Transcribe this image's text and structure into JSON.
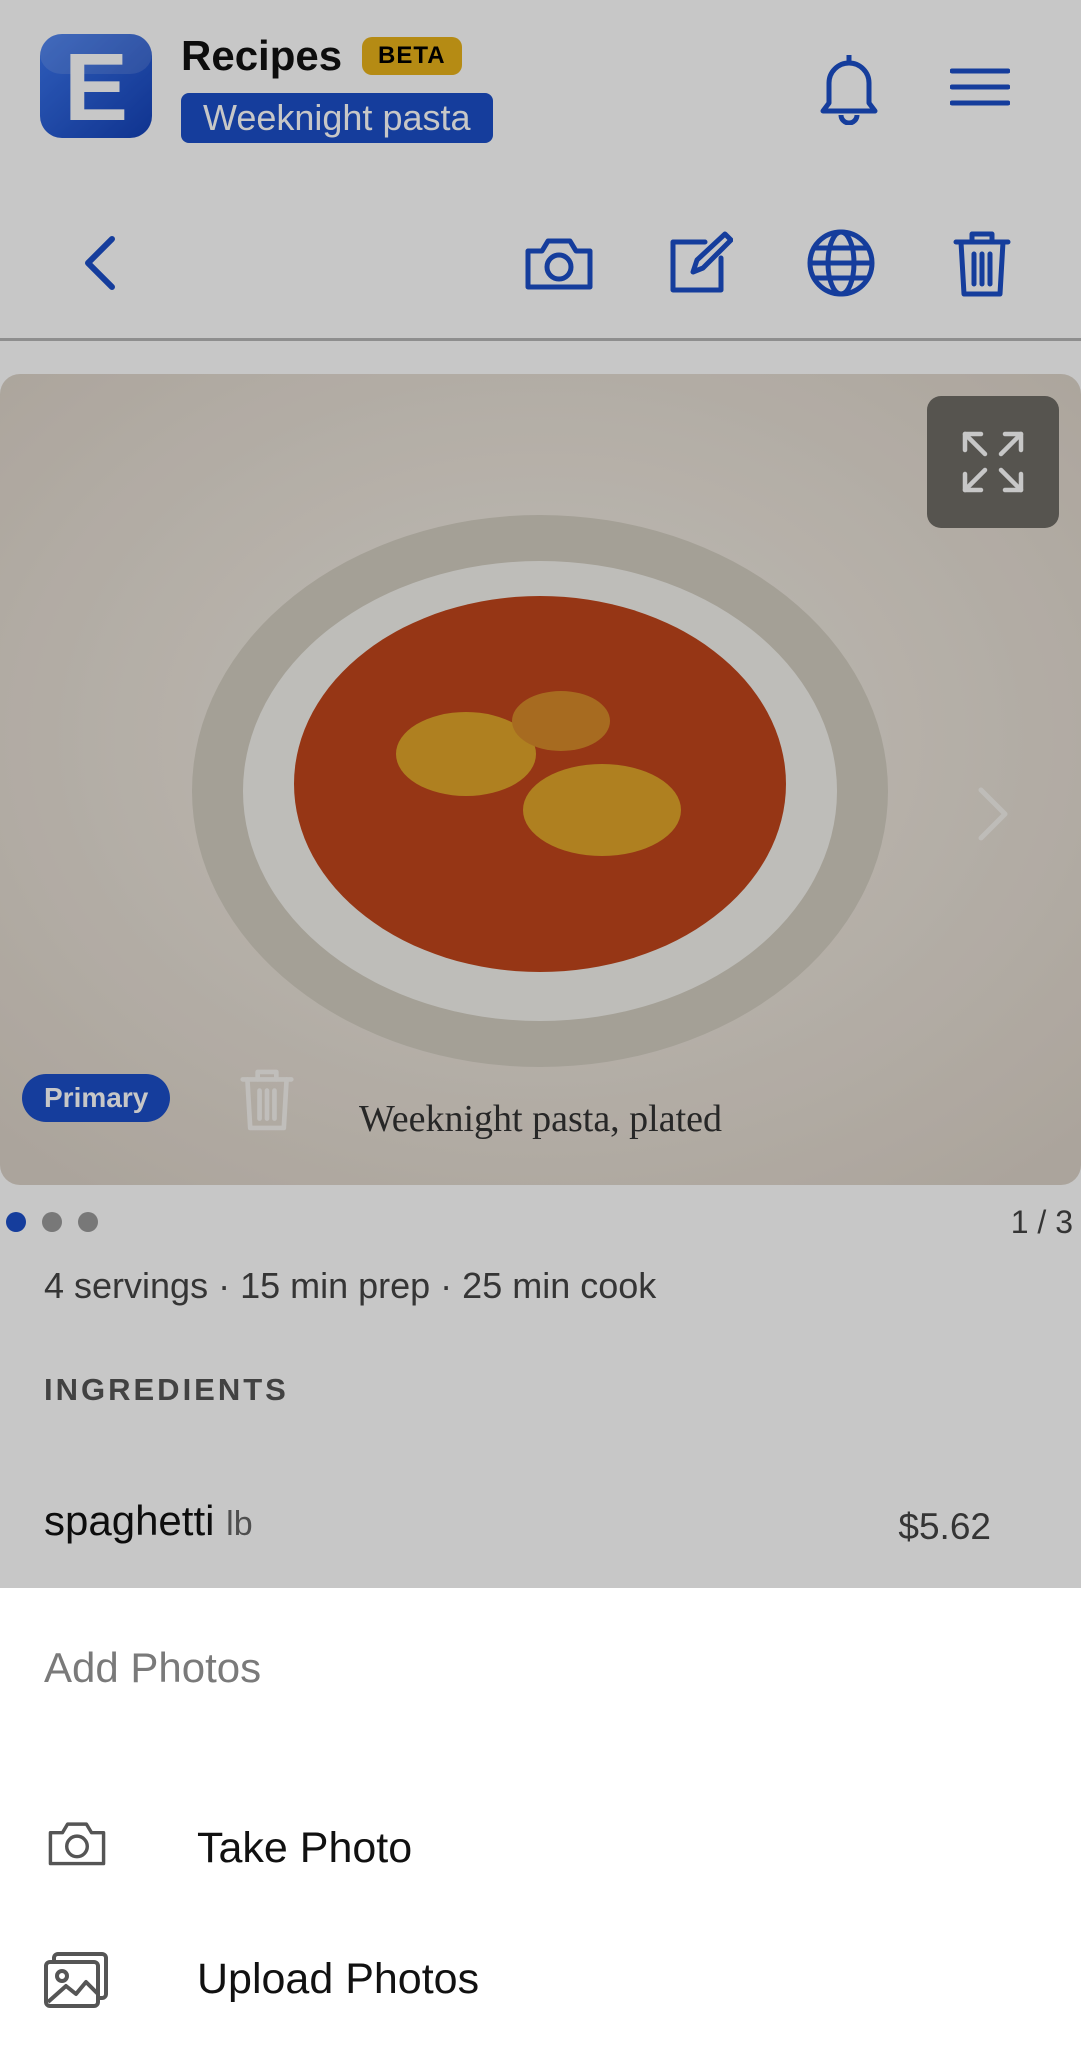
{
  "header": {
    "logo_letter": "E",
    "app_title": "Recipes",
    "beta_badge": "BETA",
    "recipe_name": "Weeknight pasta",
    "icons": [
      "bell-icon",
      "hamburger-menu-icon"
    ]
  },
  "toolbar": {
    "icons": [
      "back-chevron-icon",
      "camera-icon",
      "edit-icon",
      "globe-icon",
      "trash-icon"
    ]
  },
  "photo": {
    "badge": "Primary",
    "caption": "Weeknight pasta, plated",
    "counter": "1 / 3",
    "total_dots": 3,
    "active_dot": 1
  },
  "meta": "4 servings · 15 min prep · 25 min cook",
  "ingredients": {
    "heading": "INGREDIENTS",
    "items": [
      {
        "name": "spaghetti",
        "unit": "lb",
        "price": "$5.62"
      }
    ]
  },
  "sheet": {
    "title": "Add Photos",
    "options": [
      {
        "label": "Take Photo",
        "icon": "camera-icon"
      },
      {
        "label": "Upload Photos",
        "icon": "image-gallery-icon"
      }
    ]
  },
  "colors": {
    "accent": "#1b4fc8",
    "beta": "#e8b21a",
    "sauce": "#c1461b",
    "overlay": "rgba(0,0,0,0.22)"
  }
}
